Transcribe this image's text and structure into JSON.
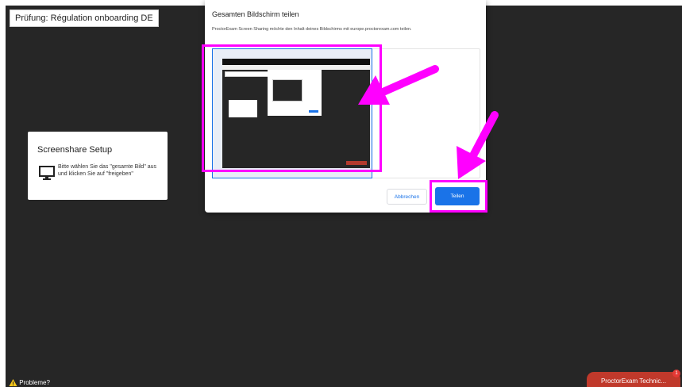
{
  "header": {
    "exam_title": "Prüfung: Régulation onboarding DE"
  },
  "setup_card": {
    "title": "Screenshare Setup",
    "icon": "monitor-icon",
    "instruction": "Bitte wählen Sie das \"gesamte Bild\" aus und klicken Sie auf \"freigeben\""
  },
  "share_dialog": {
    "title": "Gesamten Bildschirm teilen",
    "description": "ProctorExam Screen Sharing möchte den Inhalt deines Bildschirms mit europe.proctorexam.com teilen.",
    "cancel_label": "Abbrechen",
    "share_label": "Teilen"
  },
  "footer": {
    "problems_label": "Probleme?",
    "problems_icon": "warning-icon",
    "support_label": "ProctorExam Technic...",
    "support_badge": "1"
  },
  "colors": {
    "background": "#262626",
    "accent": "#1a73e8",
    "highlight": "#ff00ff",
    "support": "#c0392b"
  }
}
